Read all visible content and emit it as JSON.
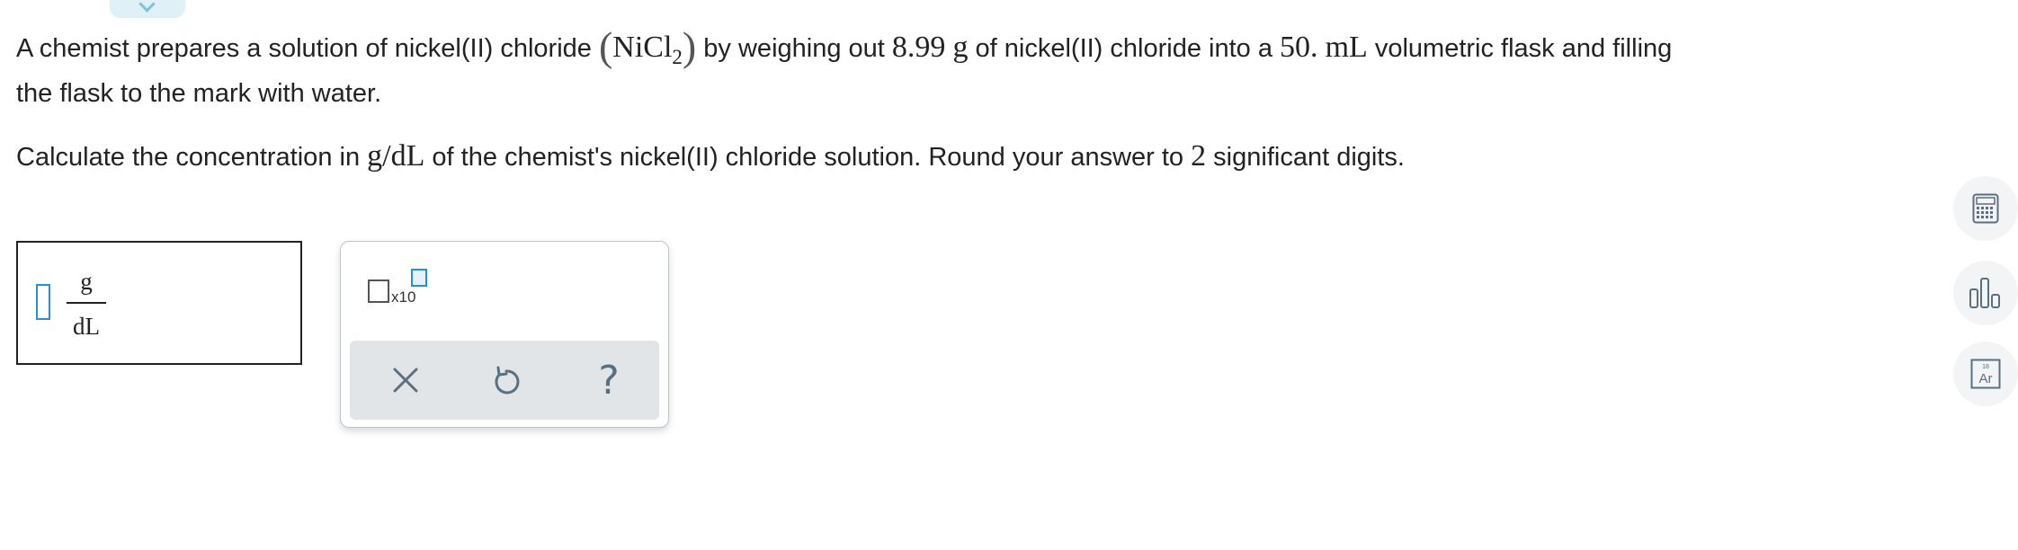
{
  "question": {
    "line1_prefix": "A chemist prepares a solution of nickel(II) chloride ",
    "formula_main": "NiCl",
    "formula_sub": "2",
    "line1_mid": " by weighing out ",
    "mass_value": "8.99",
    "mass_unit": "g",
    "line1_mid2": " of nickel(II) chloride into a ",
    "volume_value": "50.",
    "volume_unit": "mL",
    "line1_end": " volumetric flask and filling",
    "line2": "the flask to the mark with water.",
    "line3_prefix": "Calculate the concentration in ",
    "conc_unit": "g/dL",
    "line3_mid": " of the chemist's nickel(II) chloride solution. Round your answer to ",
    "sig_digits": "2",
    "line3_end": " significant digits."
  },
  "answer": {
    "value": "",
    "unit_numerator": "g",
    "unit_denominator": "dL"
  },
  "palette": {
    "sci_label": "x10",
    "clear_icon": "close-icon",
    "undo_icon": "undo-icon",
    "help_label": "?"
  },
  "side_tools": [
    {
      "icon": "calculator-icon"
    },
    {
      "icon": "bar-chart-icon"
    },
    {
      "icon": "periodic-table-icon",
      "number": "18",
      "symbol": "Ar"
    }
  ],
  "colors": {
    "accent": "#2a8fd1",
    "palette_bar": "#e2e5e8",
    "icon": "#5a6f80"
  }
}
